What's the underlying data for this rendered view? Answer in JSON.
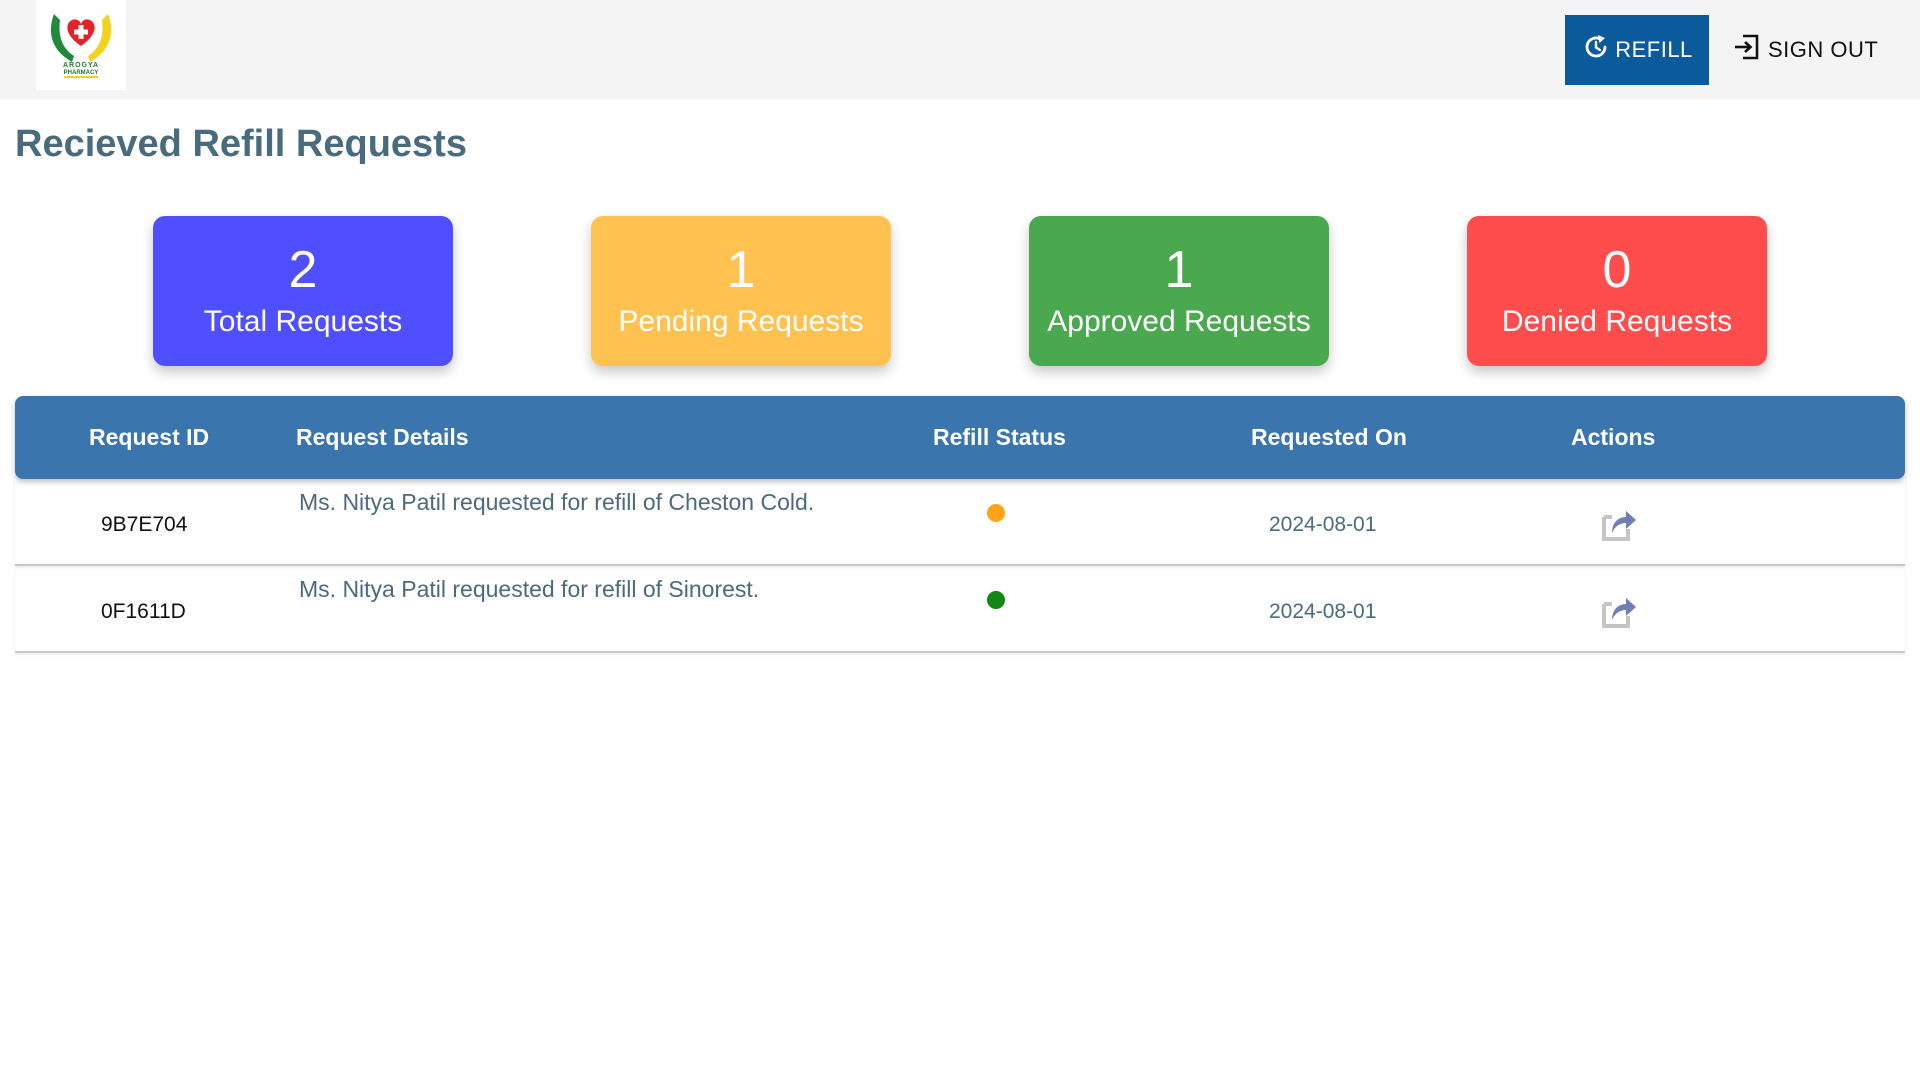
{
  "header": {
    "logo_icon": "arogya-pharmacy-logo",
    "logo_text_line1": "AROGYA",
    "logo_text_line2": "PHARMACY",
    "refill_label": "REFILL",
    "refill_icon": "refresh-clock-icon",
    "signout_label": "SIGN OUT",
    "signout_icon": "sign-in-arrow-icon",
    "accent_color": "#0b5a9c"
  },
  "page": {
    "title": "Recieved Refill Requests"
  },
  "stats": [
    {
      "value": "2",
      "label": "Total Requests",
      "color": "#4f4fff"
    },
    {
      "value": "1",
      "label": "Pending Requests",
      "color": "#ffc14f"
    },
    {
      "value": "1",
      "label": "Approved Requests",
      "color": "#4aa84e"
    },
    {
      "value": "0",
      "label": "Denied Requests",
      "color": "#ff4c4c"
    }
  ],
  "table": {
    "columns": [
      "Request ID",
      "Request Details",
      "Refill Status",
      "Requested On",
      "Actions"
    ],
    "header_color": "#3a76ad",
    "rows": [
      {
        "id": "9B7E704",
        "details": "Ms. Nitya Patil requested for refill of Cheston Cold.",
        "status": "pending",
        "status_color": "#ffa31a",
        "requested_on": "2024-08-01",
        "action_icon": "share-forward-icon"
      },
      {
        "id": "0F1611D",
        "details": "Ms. Nitya Patil requested for refill of Sinorest.",
        "status": "approved",
        "status_color": "#118811",
        "requested_on": "2024-08-01",
        "action_icon": "share-forward-icon"
      }
    ]
  }
}
